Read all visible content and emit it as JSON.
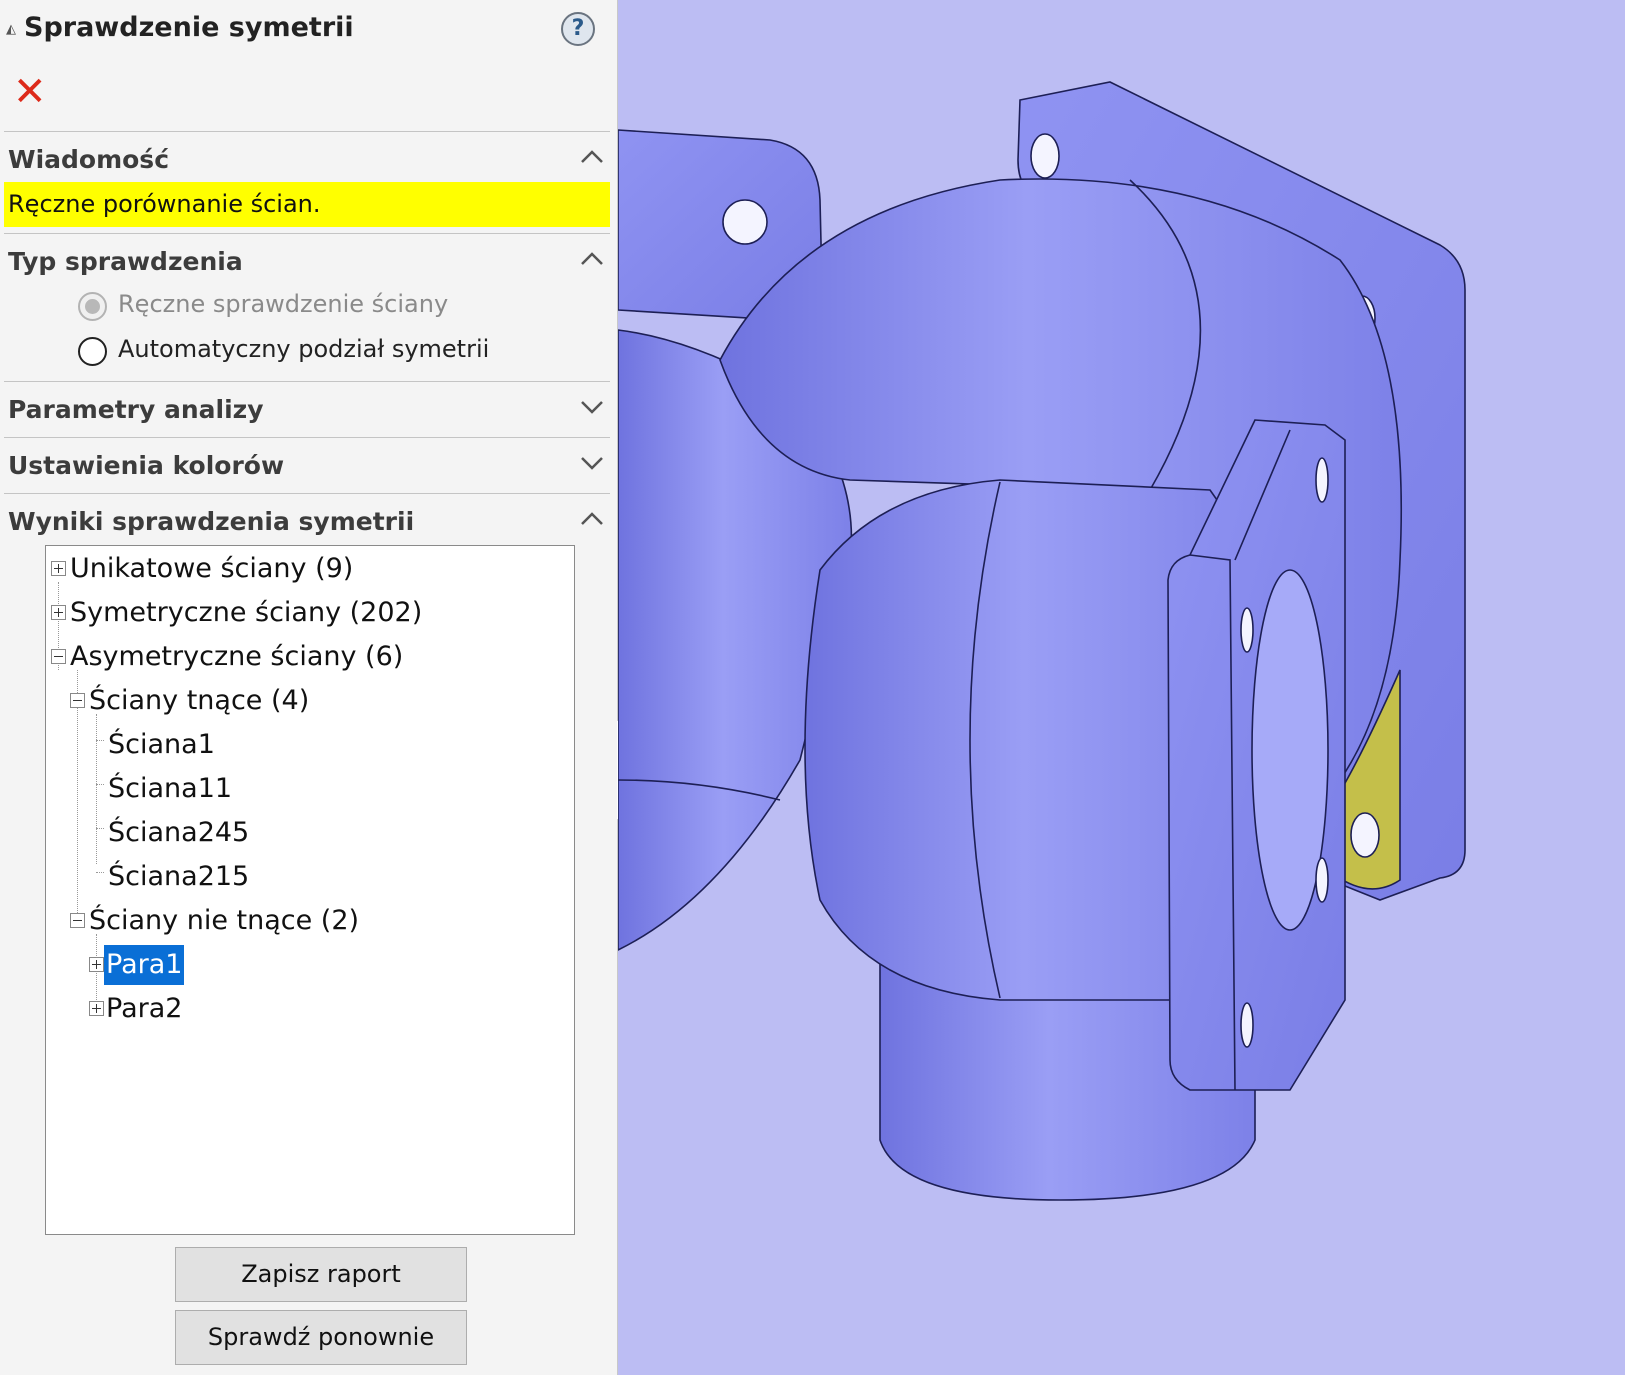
{
  "panel": {
    "title": "Sprawdzenie symetrii",
    "help_icon": "help-icon",
    "help_glyph": "?",
    "cancel_icon": "close-icon",
    "cancel_glyph": "✕"
  },
  "sections": {
    "message": {
      "title": "Wiadomość",
      "text": "Ręczne porównanie ścian.",
      "highlight_color": "#ffff00"
    },
    "check_type": {
      "title": "Typ sprawdzenia",
      "options": [
        {
          "label": "Ręczne sprawdzenie ściany",
          "selected": true,
          "enabled": false
        },
        {
          "label": "Automatyczny podział symetrii",
          "selected": false,
          "enabled": true
        }
      ]
    },
    "analysis_params": {
      "title": "Parametry analizy"
    },
    "color_settings": {
      "title": "Ustawienia kolorów"
    },
    "results": {
      "title": "Wyniki sprawdzenia symetrii"
    }
  },
  "tree": {
    "unique": "Unikatowe ściany (9)",
    "symmetric": "Symetryczne ściany (202)",
    "asymmetric": "Asymetryczne ściany (6)",
    "cutting": "Ściany tnące (4)",
    "cutting_items": [
      "Ściana1",
      "Ściana11",
      "Ściana245",
      "Ściana215"
    ],
    "non_cutting": "Ściany nie tnące (2)",
    "pairs": [
      "Para1",
      "Para2"
    ],
    "selected": "Para1",
    "selection_color": "#0a6fd6"
  },
  "buttons": {
    "save_report": "Zapisz raport",
    "recheck": "Sprawdź ponownie"
  },
  "viewport": {
    "background": "#bcbdf3",
    "model_color": "#8a8ef0",
    "highlight_face_color": "#c4bf4a"
  }
}
